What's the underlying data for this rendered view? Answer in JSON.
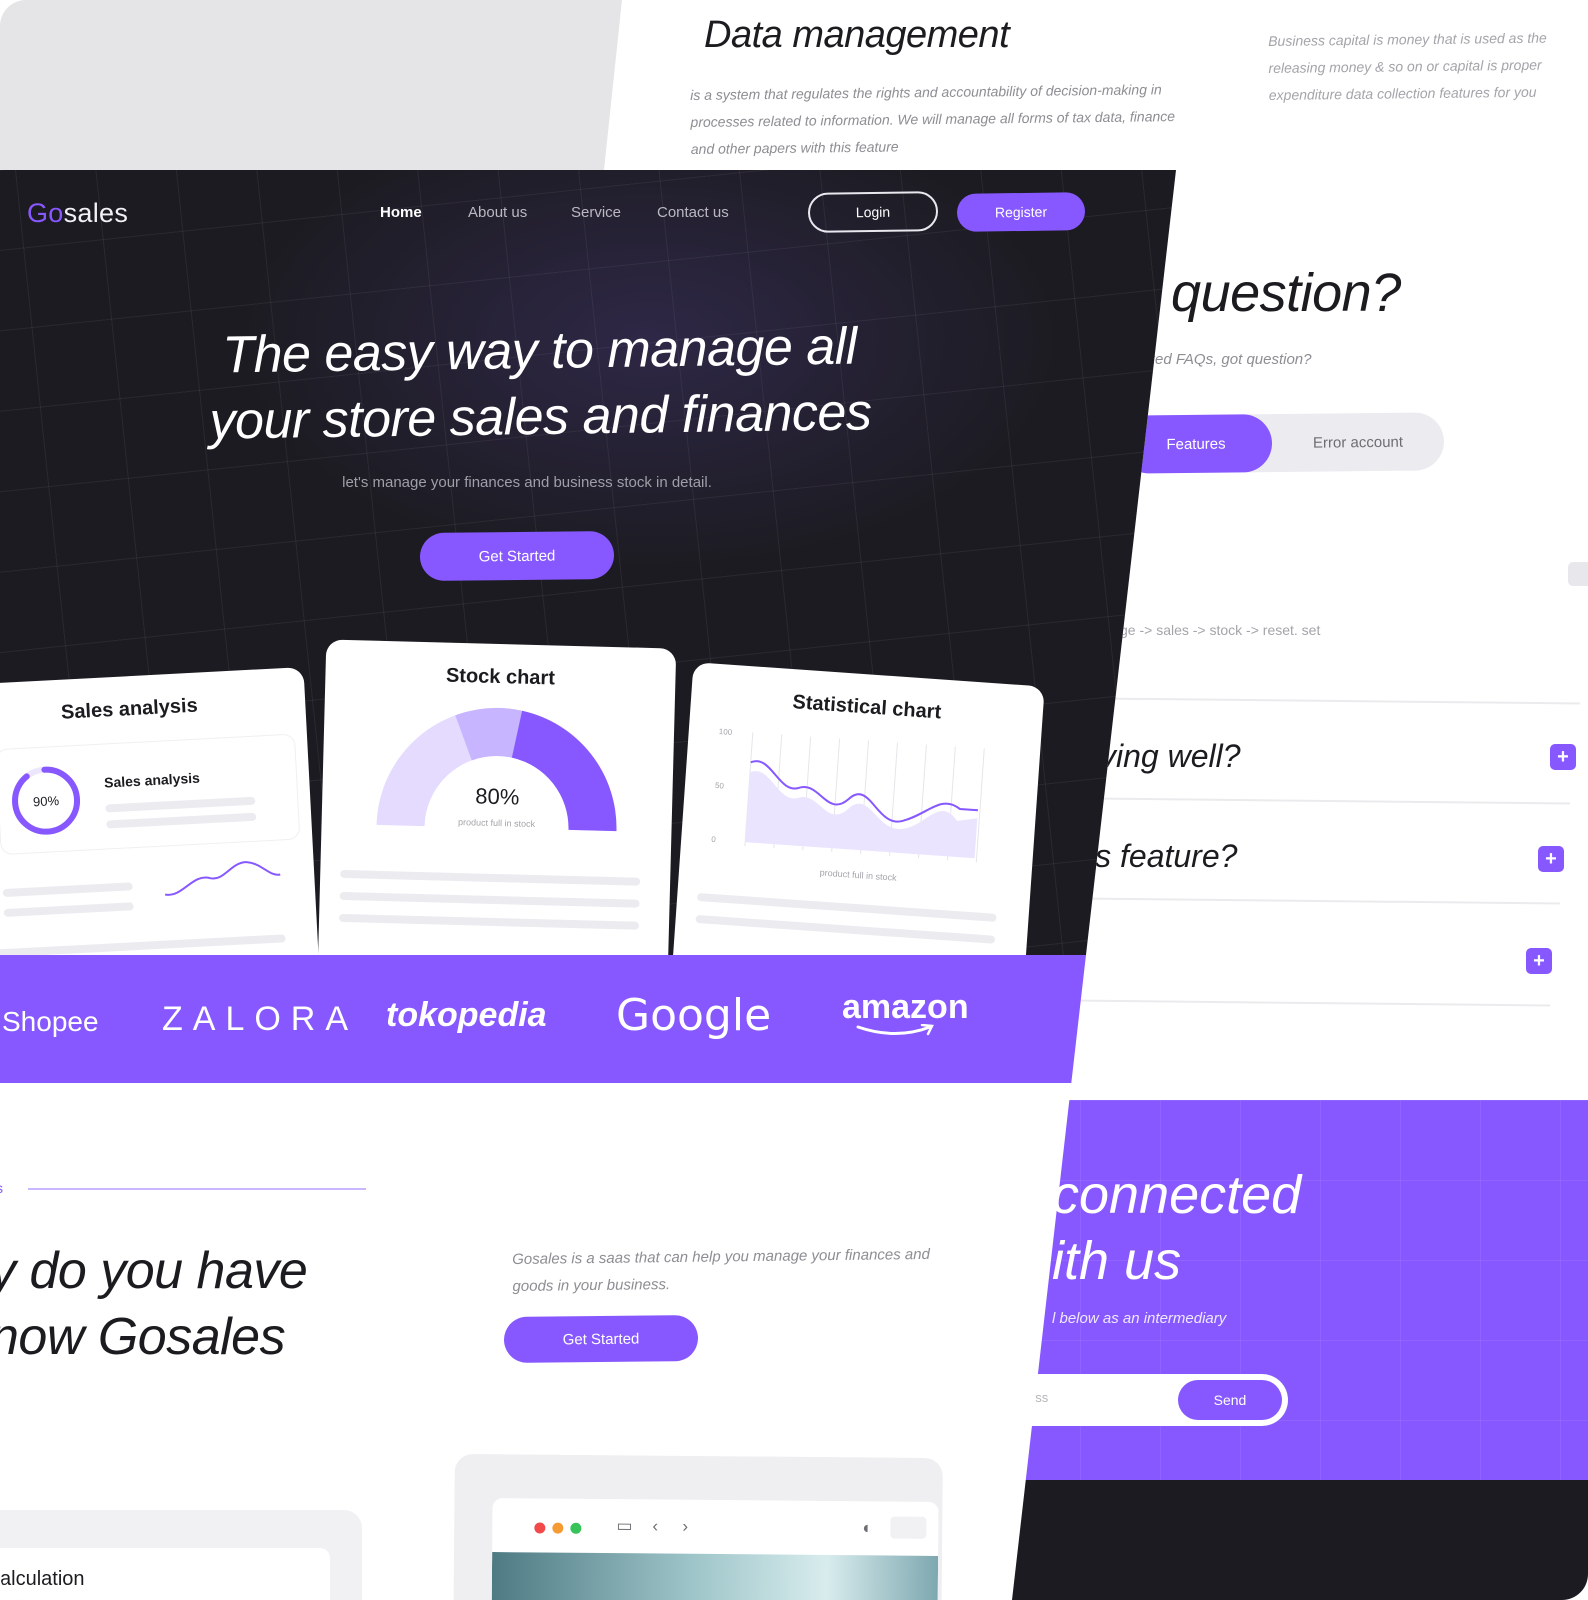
{
  "colors": {
    "accent": "#8758ff",
    "dark": "#1c1b21",
    "text": "#1b1b20",
    "muted": "#8d8d93"
  },
  "back_page": {
    "data_management": {
      "title": "Data management",
      "text": "is a system that regulates the rights and accountability of decision-making in processes related to information. We will manage all forms of tax data, finance and other papers with this feature"
    },
    "business_capital": {
      "text": "Business capital is money that is used as the releasing money & so on or capital is proper expenditure data collection features for you"
    },
    "faq": {
      "title": "our question?",
      "subtitle": "y asked FAQs, got question?",
      "tabs": [
        {
          "label": "Features"
        },
        {
          "label": "Error account"
        }
      ],
      "hint": "ge -> sales -> stock -> reset. set",
      "questions": [
        {
          "label": "ving well?"
        },
        {
          "label": "is feature?"
        },
        {
          "label": ""
        }
      ],
      "plus_icon": "plus-icon"
    },
    "newsletter": {
      "title_line1": "connected",
      "title_line2": "ith us",
      "subtitle": "l below as an intermediary",
      "input_placeholder": "ess",
      "send_label": "Send"
    }
  },
  "front_page": {
    "logo": {
      "accent": "Go",
      "rest": "sales"
    },
    "nav": [
      {
        "label": "Home"
      },
      {
        "label": "About us"
      },
      {
        "label": "Service"
      },
      {
        "label": "Contact us"
      }
    ],
    "login_label": "Login",
    "register_label": "Register",
    "hero": {
      "title_line1": "The easy way to manage all",
      "title_line2": "your store sales and finances",
      "subtitle": "let's manage your finances and business stock in detail.",
      "cta_label": "Get Started"
    },
    "cards": {
      "sales": {
        "title": "Sales analysis",
        "inner_title": "Sales analysis",
        "ring_label": "90%",
        "ring_value": 0.9
      },
      "stock": {
        "title": "Stock chart",
        "value_label": "80%",
        "value": 0.8,
        "caption": "product full in stock"
      },
      "stat": {
        "title": "Statistical chart",
        "ticks": [
          "100",
          "50",
          "0"
        ],
        "caption": "product full in stock"
      }
    },
    "partners": [
      "Shopee",
      "ZALORA",
      "tokopedia",
      "Google",
      "amazon"
    ],
    "about": {
      "eyebrow": "s",
      "title_line1": "y do you have",
      "title_line2": "now Gosales",
      "text": "Gosales is a saas that can help you manage your finances and goods in your business.",
      "cta_label": "Get Started"
    },
    "calc": {
      "label": "alculation"
    }
  }
}
